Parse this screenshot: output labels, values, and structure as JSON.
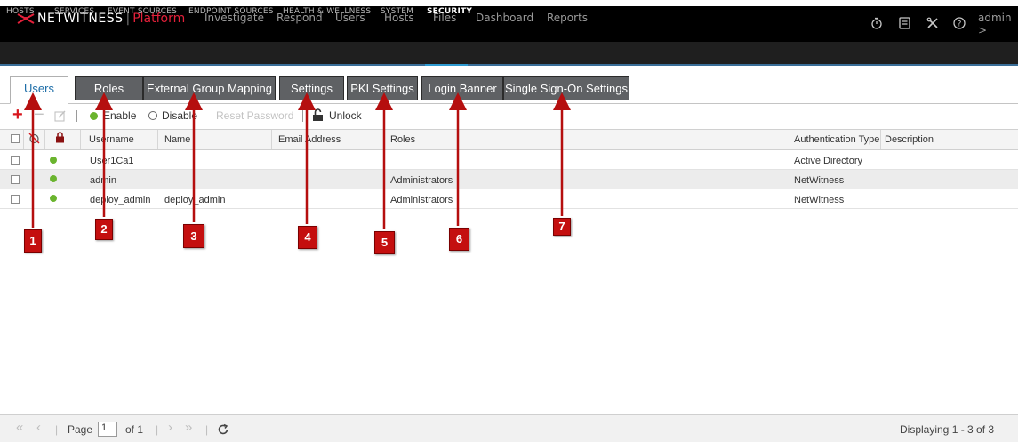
{
  "app": {
    "logo_text": "NETWITNESS",
    "logo_sep": "|",
    "logo_platform": "Platform",
    "brand_color": "#e4203a"
  },
  "topnav": [
    "Investigate",
    "Respond",
    "Users",
    "Hosts",
    "Files",
    "Dashboard",
    "Reports"
  ],
  "topright": {
    "icons": [
      "timer-icon",
      "notes-icon",
      "tools-icon",
      "help-icon"
    ],
    "user": "admin >"
  },
  "subnav": {
    "items": [
      "HOSTS",
      "SERVICES",
      "EVENT SOURCES",
      "ENDPOINT SOURCES",
      "HEALTH & WELLNESS",
      "SYSTEM",
      "SECURITY"
    ],
    "active": "SECURITY"
  },
  "tabs": [
    "Users",
    "Roles",
    "External Group Mapping",
    "Settings",
    "PKI Settings",
    "Login Banner",
    "Single Sign-On Settings"
  ],
  "active_tab": "Users",
  "toolbar": {
    "add": "+",
    "remove": "−",
    "enable": "Enable",
    "disable": "Disable",
    "reset_password": "Reset Password",
    "unlock": "Unlock"
  },
  "table": {
    "columns": [
      "Username",
      "Name",
      "Email Address",
      "Roles",
      "Authentication Type",
      "Description"
    ],
    "rows": [
      {
        "username": "User1Ca1",
        "name": "",
        "email": "",
        "roles": "",
        "auth": "Active Directory",
        "description": "",
        "enabled": true
      },
      {
        "username": "admin",
        "name": "",
        "email": "",
        "roles": "Administrators",
        "auth": "NetWitness",
        "description": "",
        "enabled": true
      },
      {
        "username": "deploy_admin",
        "name": "deploy_admin",
        "email": "",
        "roles": "Administrators",
        "auth": "NetWitness",
        "description": "",
        "enabled": true
      }
    ]
  },
  "footer": {
    "page_label": "Page",
    "page_value": "1",
    "of_label": "of 1",
    "displaying": "Displaying 1 - 3 of 3"
  },
  "callouts": [
    "1",
    "2",
    "3",
    "4",
    "5",
    "6",
    "7"
  ],
  "callout_color": "#c40f0f"
}
